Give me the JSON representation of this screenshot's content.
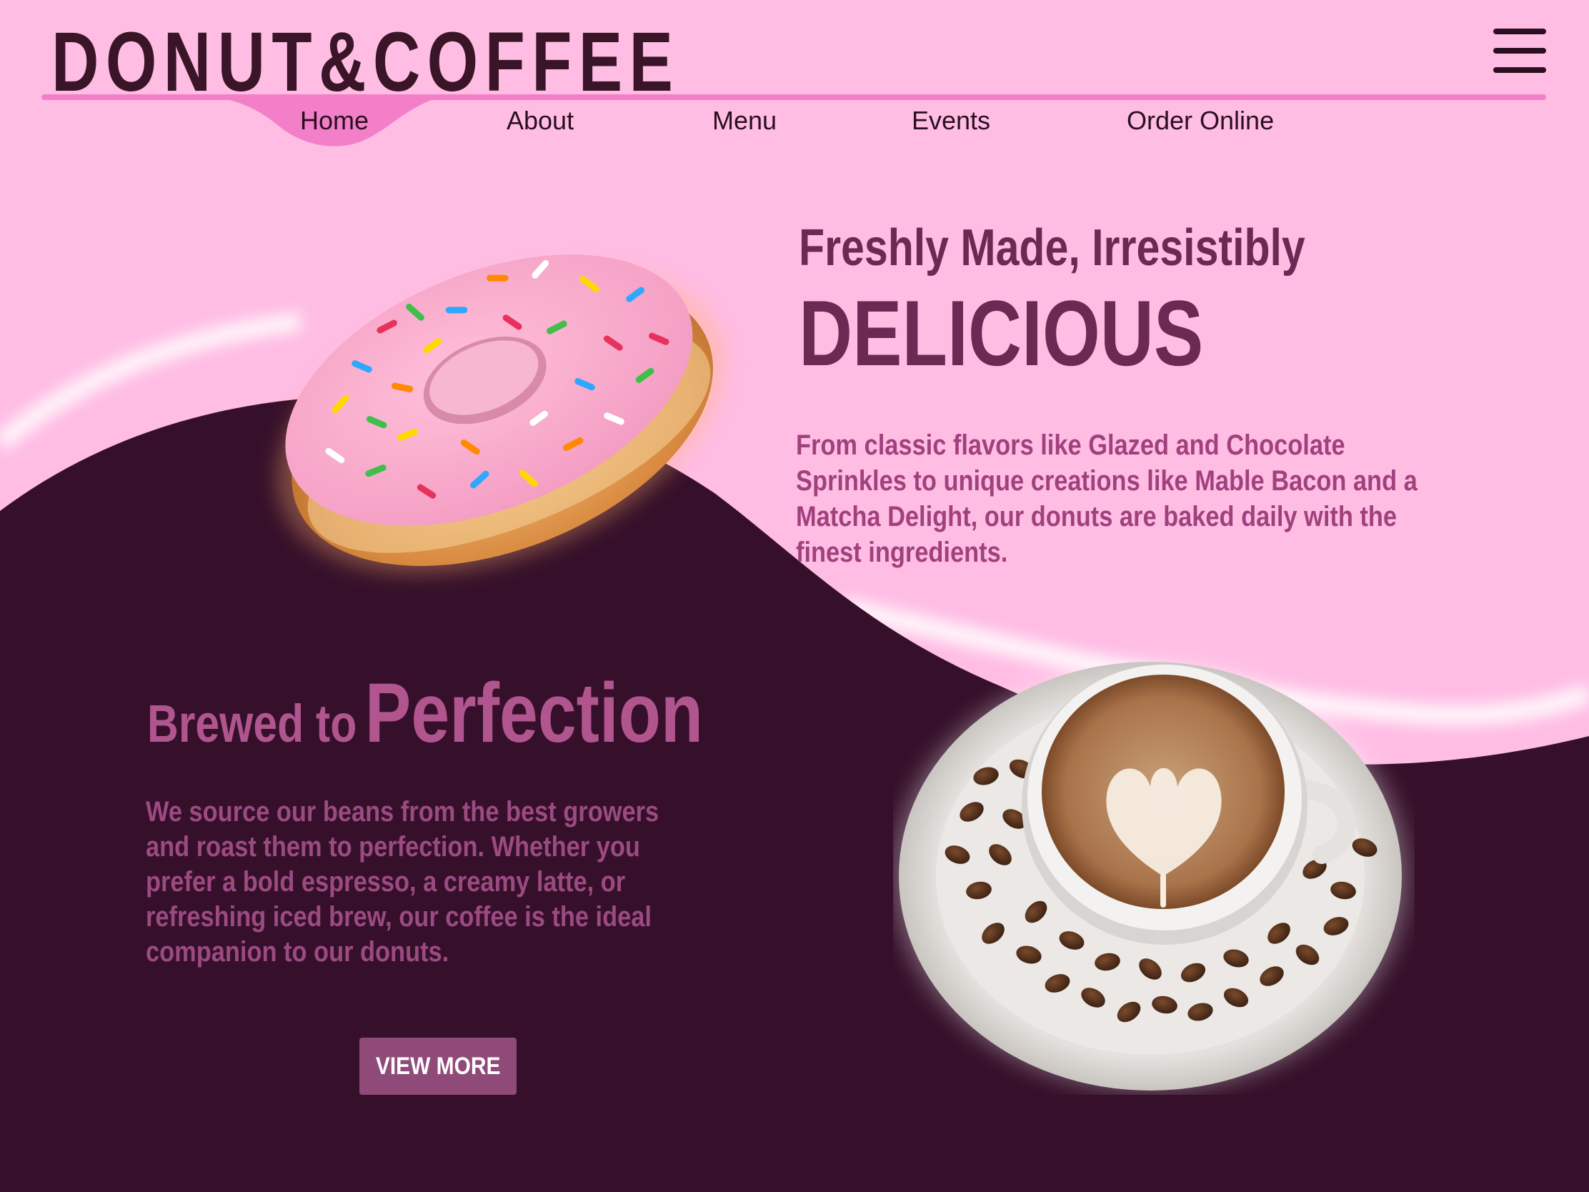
{
  "header": {
    "logo_text": "DONUT&COFFEE",
    "menu_icon": "hamburger-menu-icon"
  },
  "nav": {
    "items": [
      {
        "label": "Home",
        "active": true
      },
      {
        "label": "About",
        "active": false
      },
      {
        "label": "Menu",
        "active": false
      },
      {
        "label": "Events",
        "active": false
      },
      {
        "label": "Order Online",
        "active": false
      }
    ]
  },
  "donut_section": {
    "subtitle": "Freshly Made, Irresistibly",
    "title": "DELICIOUS",
    "description": "From classic flavors like Glazed and Chocolate Sprinkles to unique creations like Mable Bacon and a Matcha Delight, our donuts are baked daily with the finest ingredients.",
    "image": "pink-sprinkle-donut-image"
  },
  "coffee_section": {
    "title_small": "Brewed to",
    "title_big": "Perfection",
    "description": "We source our beans from the best growers and roast them to perfection. Whether you prefer a bold espresso, a creamy latte, or refreshing iced brew, our coffee is the ideal companion to our donuts.",
    "button_label": "VIEW MORE",
    "image": "latte-with-coffee-beans-image"
  },
  "colors": {
    "background_pink": "#ffbde4",
    "background_dark": "#36102a",
    "accent_pink": "#f27fc8",
    "heading_purple": "#6a2a54",
    "body_pink": "#a0417e",
    "button_bg": "#8f4a79"
  }
}
